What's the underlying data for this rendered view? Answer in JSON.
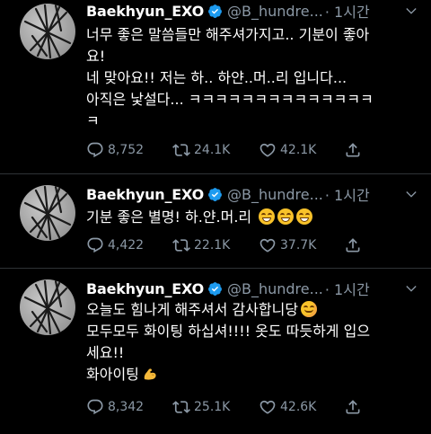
{
  "tweets": [
    {
      "name": "Baekhyun_EXO",
      "handle": "@B_hundre...",
      "time": "· 1시간",
      "lines": [
        "너무 좋은 말씀들만 해주셔가지고.. 기분이 좋아",
        "요!",
        "네 맞아요!! 저는 하.. 하얀..머..리 입니다...",
        "아직은 낯설다... ㅋㅋㅋㅋㅋㅋㅋㅋㅋㅋㅋㅋㅋㅋ",
        "ㅋ"
      ],
      "replies": "8,752",
      "retweets": "24.1K",
      "likes": "42.1K"
    },
    {
      "name": "Baekhyun_EXO",
      "handle": "@B_hundre...",
      "time": "· 1시간",
      "lines": [
        "기분 좋은 별명! 하.얀.머.리"
      ],
      "emoji": [
        "grinning-face",
        "grinning-face",
        "grinning-face"
      ],
      "replies": "4,422",
      "retweets": "22.1K",
      "likes": "37.7K"
    },
    {
      "name": "Baekhyun_EXO",
      "handle": "@B_hundre...",
      "time": "· 1시간",
      "lines": [
        "오늘도 힘나게 해주셔서 감사합니당",
        "모두모두 화이팅 하십셔!!!! 옷도 따듯하게 입으",
        "세요!!",
        "화아이팅"
      ],
      "emoji": [
        "smiling-face",
        "flexed-biceps"
      ],
      "replies": "8,342",
      "retweets": "25.1K",
      "likes": "42.6K"
    }
  ],
  "colors": {
    "background": "#000000",
    "secondary_text": "#8b98a5",
    "verified": "#1d9bf0",
    "separator": "#2f3336"
  }
}
